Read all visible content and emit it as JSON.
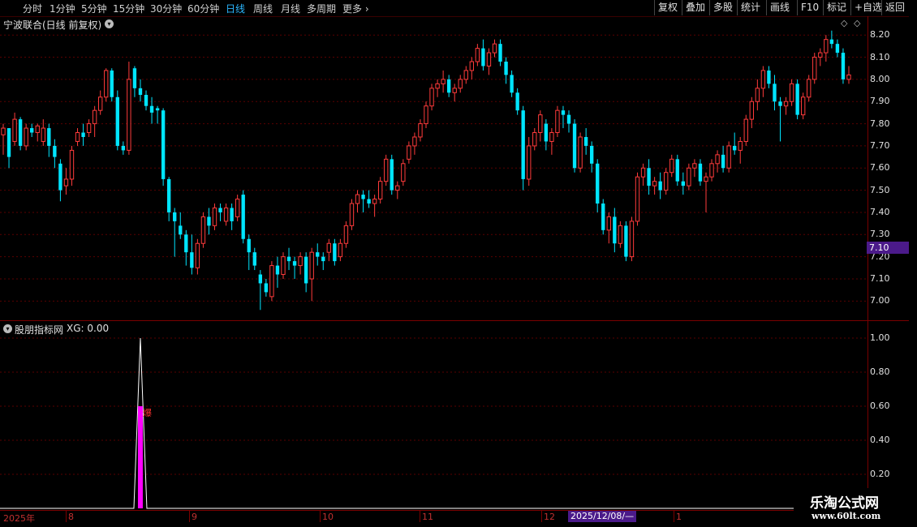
{
  "toolbar": {
    "periods": [
      "分时",
      "1分钟",
      "5分钟",
      "15分钟",
      "30分钟",
      "60分钟",
      "日线",
      "周线",
      "月线",
      "多周期",
      "更多"
    ],
    "active_period": "日线",
    "right_buttons": [
      "复权",
      "叠加",
      "多股",
      "统计",
      "画线",
      "F10",
      "标记",
      "+自选",
      "返回"
    ]
  },
  "main_panel": {
    "title": "宁波联合(日线 前复权)",
    "price_ticks": [
      "8.20",
      "8.10",
      "8.00",
      "7.90",
      "7.80",
      "7.70",
      "7.60",
      "7.50",
      "7.40",
      "7.30",
      "7.20",
      "7.10",
      "7.00"
    ],
    "current_price_tag": "7.10"
  },
  "indicator_panel": {
    "title": "股朋指标网",
    "xg_label": "XG: 0.00",
    "ticks": [
      "1.00",
      "0.80",
      "0.60",
      "0.40",
      "0.20"
    ],
    "signal_text": "爆"
  },
  "xaxis": {
    "labels": [
      "2025年",
      "8",
      "9",
      "10",
      "11",
      "12",
      "1"
    ],
    "cursor_date": "2025/12/08/—"
  },
  "watermark": {
    "line1": "乐淘公式网",
    "line2": "www.60lt.com"
  },
  "colors": {
    "up": "#ff3b3b",
    "down": "#00e5ff",
    "grid": "#7a0000",
    "accent": "#4b1a8a",
    "signal": "#ff00ff"
  },
  "chart_data": {
    "type": "candlestick",
    "yrange": [
      6.95,
      8.23
    ],
    "candles": [
      [
        7.75,
        7.8,
        7.66,
        7.78
      ],
      [
        7.78,
        7.78,
        7.6,
        7.65
      ],
      [
        7.72,
        7.85,
        7.7,
        7.82
      ],
      [
        7.82,
        7.83,
        7.68,
        7.7
      ],
      [
        7.7,
        7.8,
        7.68,
        7.78
      ],
      [
        7.78,
        7.8,
        7.74,
        7.76
      ],
      [
        7.76,
        7.8,
        7.72,
        7.79
      ],
      [
        7.72,
        7.82,
        7.7,
        7.78
      ],
      [
        7.78,
        7.8,
        7.65,
        7.7
      ],
      [
        7.7,
        7.73,
        7.6,
        7.65
      ],
      [
        7.62,
        7.64,
        7.45,
        7.5
      ],
      [
        7.52,
        7.6,
        7.48,
        7.55
      ],
      [
        7.55,
        7.7,
        7.52,
        7.68
      ],
      [
        7.72,
        7.78,
        7.7,
        7.76
      ],
      [
        7.76,
        7.8,
        7.7,
        7.74
      ],
      [
        7.76,
        7.82,
        7.74,
        7.8
      ],
      [
        7.8,
        7.88,
        7.74,
        7.86
      ],
      [
        7.86,
        7.95,
        7.84,
        7.92
      ],
      [
        7.92,
        8.05,
        7.9,
        8.04
      ],
      [
        8.04,
        8.05,
        7.9,
        7.92
      ],
      [
        7.92,
        7.95,
        7.68,
        7.7
      ],
      [
        7.7,
        7.72,
        7.66,
        7.68
      ],
      [
        7.68,
        8.08,
        7.66,
        8.0
      ],
      [
        8.05,
        8.06,
        7.92,
        7.96
      ],
      [
        7.96,
        8.0,
        7.9,
        7.93
      ],
      [
        7.93,
        7.95,
        7.86,
        7.88
      ],
      [
        7.88,
        7.92,
        7.8,
        7.85
      ],
      [
        7.87,
        7.88,
        7.8,
        7.86
      ],
      [
        7.86,
        7.87,
        7.52,
        7.55
      ],
      [
        7.55,
        7.56,
        7.36,
        7.4
      ],
      [
        7.4,
        7.42,
        7.2,
        7.36
      ],
      [
        7.34,
        7.4,
        7.28,
        7.3
      ],
      [
        7.3,
        7.32,
        7.16,
        7.22
      ],
      [
        7.22,
        7.3,
        7.12,
        7.15
      ],
      [
        7.15,
        7.28,
        7.12,
        7.26
      ],
      [
        7.26,
        7.4,
        7.24,
        7.38
      ],
      [
        7.38,
        7.42,
        7.3,
        7.34
      ],
      [
        7.34,
        7.44,
        7.32,
        7.42
      ],
      [
        7.42,
        7.44,
        7.36,
        7.4
      ],
      [
        7.36,
        7.44,
        7.34,
        7.42
      ],
      [
        7.42,
        7.44,
        7.32,
        7.36
      ],
      [
        7.38,
        7.48,
        7.36,
        7.46
      ],
      [
        7.48,
        7.5,
        7.26,
        7.28
      ],
      [
        7.28,
        7.3,
        7.14,
        7.22
      ],
      [
        7.22,
        7.24,
        7.14,
        7.16
      ],
      [
        7.12,
        7.14,
        6.96,
        7.08
      ],
      [
        7.08,
        7.1,
        7.02,
        7.04
      ],
      [
        7.02,
        7.18,
        7.0,
        7.16
      ],
      [
        7.16,
        7.2,
        7.06,
        7.12
      ],
      [
        7.12,
        7.22,
        7.1,
        7.2
      ],
      [
        7.2,
        7.24,
        7.14,
        7.18
      ],
      [
        7.18,
        7.2,
        7.1,
        7.16
      ],
      [
        7.16,
        7.22,
        7.12,
        7.2
      ],
      [
        7.2,
        7.22,
        7.04,
        7.08
      ],
      [
        7.1,
        7.24,
        7.0,
        7.22
      ],
      [
        7.22,
        7.26,
        7.16,
        7.2
      ],
      [
        7.2,
        7.22,
        7.14,
        7.18
      ],
      [
        7.22,
        7.28,
        7.18,
        7.26
      ],
      [
        7.26,
        7.28,
        7.16,
        7.18
      ],
      [
        7.2,
        7.28,
        7.18,
        7.26
      ],
      [
        7.26,
        7.36,
        7.24,
        7.34
      ],
      [
        7.34,
        7.46,
        7.32,
        7.44
      ],
      [
        7.44,
        7.5,
        7.4,
        7.48
      ],
      [
        7.48,
        7.5,
        7.4,
        7.46
      ],
      [
        7.46,
        7.5,
        7.42,
        7.44
      ],
      [
        7.44,
        7.48,
        7.38,
        7.46
      ],
      [
        7.46,
        7.56,
        7.44,
        7.54
      ],
      [
        7.54,
        7.66,
        7.52,
        7.64
      ],
      [
        7.64,
        7.66,
        7.48,
        7.5
      ],
      [
        7.5,
        7.54,
        7.46,
        7.52
      ],
      [
        7.54,
        7.64,
        7.52,
        7.62
      ],
      [
        7.64,
        7.72,
        7.62,
        7.7
      ],
      [
        7.7,
        7.76,
        7.66,
        7.74
      ],
      [
        7.74,
        7.82,
        7.72,
        7.8
      ],
      [
        7.8,
        7.9,
        7.78,
        7.88
      ],
      [
        7.88,
        7.98,
        7.86,
        7.96
      ],
      [
        7.96,
        8.0,
        7.92,
        7.98
      ],
      [
        7.98,
        8.04,
        7.94,
        8.0
      ],
      [
        8.0,
        8.02,
        7.92,
        7.94
      ],
      [
        7.94,
        7.98,
        7.9,
        7.96
      ],
      [
        7.96,
        8.02,
        7.94,
        8.0
      ],
      [
        8.0,
        8.06,
        7.98,
        8.04
      ],
      [
        8.04,
        8.1,
        8.0,
        8.08
      ],
      [
        8.08,
        8.16,
        8.06,
        8.14
      ],
      [
        8.14,
        8.18,
        8.04,
        8.06
      ],
      [
        8.06,
        8.14,
        8.02,
        8.12
      ],
      [
        8.12,
        8.18,
        8.1,
        8.16
      ],
      [
        8.16,
        8.18,
        8.06,
        8.08
      ],
      [
        8.08,
        8.1,
        7.98,
        8.02
      ],
      [
        8.02,
        8.04,
        7.92,
        7.94
      ],
      [
        7.94,
        7.96,
        7.84,
        7.86
      ],
      [
        7.86,
        7.88,
        7.5,
        7.55
      ],
      [
        7.55,
        7.74,
        7.52,
        7.7
      ],
      [
        7.7,
        7.78,
        7.68,
        7.76
      ],
      [
        7.76,
        7.86,
        7.72,
        7.84
      ],
      [
        7.8,
        7.82,
        7.68,
        7.72
      ],
      [
        7.72,
        7.78,
        7.66,
        7.76
      ],
      [
        7.76,
        7.88,
        7.74,
        7.86
      ],
      [
        7.86,
        7.88,
        7.78,
        7.84
      ],
      [
        7.84,
        7.86,
        7.76,
        7.8
      ],
      [
        7.8,
        7.82,
        7.58,
        7.6
      ],
      [
        7.6,
        7.76,
        7.58,
        7.74
      ],
      [
        7.74,
        7.78,
        7.66,
        7.7
      ],
      [
        7.7,
        7.72,
        7.58,
        7.62
      ],
      [
        7.62,
        7.64,
        7.4,
        7.44
      ],
      [
        7.44,
        7.46,
        7.3,
        7.32
      ],
      [
        7.32,
        7.4,
        7.26,
        7.38
      ],
      [
        7.38,
        7.42,
        7.22,
        7.26
      ],
      [
        7.26,
        7.36,
        7.24,
        7.34
      ],
      [
        7.34,
        7.36,
        7.18,
        7.2
      ],
      [
        7.2,
        7.38,
        7.18,
        7.36
      ],
      [
        7.36,
        7.58,
        7.34,
        7.56
      ],
      [
        7.56,
        7.62,
        7.52,
        7.6
      ],
      [
        7.6,
        7.64,
        7.48,
        7.52
      ],
      [
        7.52,
        7.56,
        7.48,
        7.54
      ],
      [
        7.54,
        7.58,
        7.46,
        7.5
      ],
      [
        7.5,
        7.6,
        7.48,
        7.58
      ],
      [
        7.58,
        7.66,
        7.56,
        7.64
      ],
      [
        7.64,
        7.66,
        7.52,
        7.54
      ],
      [
        7.54,
        7.58,
        7.48,
        7.52
      ],
      [
        7.52,
        7.62,
        7.5,
        7.6
      ],
      [
        7.6,
        7.64,
        7.56,
        7.62
      ],
      [
        7.62,
        7.64,
        7.52,
        7.54
      ],
      [
        7.54,
        7.58,
        7.4,
        7.56
      ],
      [
        7.56,
        7.64,
        7.54,
        7.62
      ],
      [
        7.62,
        7.68,
        7.58,
        7.66
      ],
      [
        7.66,
        7.7,
        7.58,
        7.6
      ],
      [
        7.6,
        7.72,
        7.58,
        7.7
      ],
      [
        7.7,
        7.76,
        7.66,
        7.68
      ],
      [
        7.68,
        7.74,
        7.62,
        7.72
      ],
      [
        7.72,
        7.84,
        7.7,
        7.82
      ],
      [
        7.82,
        7.92,
        7.78,
        7.9
      ],
      [
        7.9,
        8.0,
        7.86,
        7.96
      ],
      [
        7.96,
        8.06,
        7.92,
        8.04
      ],
      [
        8.04,
        8.06,
        7.96,
        7.98
      ],
      [
        7.98,
        8.02,
        7.86,
        7.9
      ],
      [
        7.9,
        7.92,
        7.72,
        7.88
      ],
      [
        7.88,
        7.92,
        7.84,
        7.9
      ],
      [
        7.9,
        8.0,
        7.88,
        7.98
      ],
      [
        7.98,
        8.0,
        7.82,
        7.84
      ],
      [
        7.84,
        7.94,
        7.82,
        7.92
      ],
      [
        7.92,
        8.02,
        7.9,
        8.0
      ],
      [
        8.0,
        8.12,
        7.98,
        8.1
      ],
      [
        8.1,
        8.14,
        8.06,
        8.12
      ],
      [
        8.12,
        8.2,
        8.08,
        8.18
      ],
      [
        8.18,
        8.22,
        8.14,
        8.16
      ],
      [
        8.16,
        8.18,
        8.1,
        8.12
      ],
      [
        8.12,
        8.14,
        7.98,
        8.0
      ],
      [
        8.0,
        8.06,
        7.98,
        8.02
      ]
    ],
    "indicator_spike_index": 24
  }
}
